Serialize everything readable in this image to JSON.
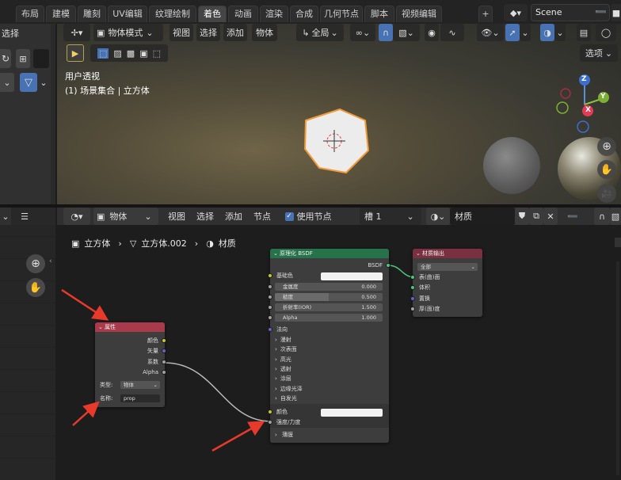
{
  "workspace_tabs": [
    "布局",
    "建模",
    "雕刻",
    "UV编辑",
    "纹理绘制",
    "着色",
    "动画",
    "渲染",
    "合成",
    "几何节点",
    "脚本",
    "视频编辑"
  ],
  "active_tab": "着色",
  "scene": {
    "name": "Scene"
  },
  "left_panel": {
    "label": "选择"
  },
  "viewport": {
    "mode": "物体模式",
    "menu": [
      "视图",
      "选择",
      "添加",
      "物体"
    ],
    "transform": "全局",
    "options": "选项",
    "overlay_title": "用户透视",
    "overlay_sub": "(1) 场景集合 | 立方体",
    "gizmo": {
      "z": "Z",
      "y": "Y",
      "x": "X"
    }
  },
  "node_editor": {
    "type": "物体",
    "menu": [
      "视图",
      "选择",
      "添加",
      "节点"
    ],
    "use_nodes": "使用节点",
    "slot": "槽 1",
    "material": "材质",
    "breadcrumb": [
      "立方体",
      "立方体.002",
      "材质"
    ]
  },
  "attr_node": {
    "title": "属性",
    "outputs": [
      "颜色",
      "矢量",
      "系数",
      "Alpha"
    ],
    "type_label": "类型:",
    "type_value": "物体",
    "name_label": "名称:",
    "name_value": "prop"
  },
  "bsdf_node": {
    "title": "原理化 BSDF",
    "output": "BSDF",
    "base_color": "基础色",
    "fields": [
      {
        "label": "金属度",
        "value": "0.000"
      },
      {
        "label": "糙度",
        "value": "0.500"
      },
      {
        "label": "折射率(IOR)",
        "value": "1.500"
      },
      {
        "label": "Alpha",
        "value": "1.000"
      }
    ],
    "normal": "法向",
    "panels": [
      "漫射",
      "次表面",
      "高光",
      "透射",
      "涂层",
      "边缘光泽",
      "自发光"
    ],
    "emit_color": "颜色",
    "emit_strength": "强度/力度",
    "thin": "薄膜"
  },
  "output_node": {
    "title": "材质输出",
    "target": "全部",
    "inputs": [
      "表(曲)面",
      "体积",
      "置换",
      "厚(面)度"
    ]
  },
  "colors": {
    "accent": "#4772b3",
    "bsdf_head": "#26734a",
    "attr_head": "#a83a4c",
    "output_head": "#7a3040",
    "arrow": "#e83a2a"
  }
}
